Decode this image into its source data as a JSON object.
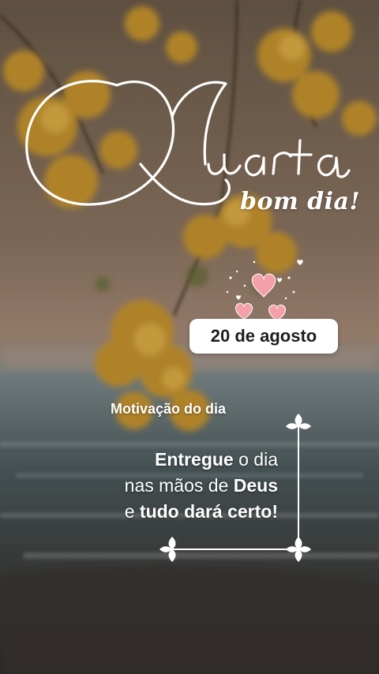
{
  "header": {
    "weekday_script": "Quarta",
    "greeting": "bom dia",
    "greeting_exclaim": "!"
  },
  "date_badge": {
    "text": "20 de agosto"
  },
  "motivation": {
    "label": "Motivação do dia",
    "quote_line1_bold": "Entregue",
    "quote_line1_rest": " o dia",
    "quote_line2_rest": "nas mãos de ",
    "quote_line2_bold": "Deus",
    "quote_line3_rest": "e ",
    "quote_line3_bold": "tudo dará certo!"
  },
  "icons": {
    "hearts": "hearts-icon",
    "frame_ornament": "leaf-ornament-icon"
  },
  "colors": {
    "text": "#ffffff",
    "badge_bg": "#ffffff",
    "badge_text": "#1e1e1e",
    "heart_pink": "#f4a0a8",
    "flower_gold": "#c8952e"
  }
}
